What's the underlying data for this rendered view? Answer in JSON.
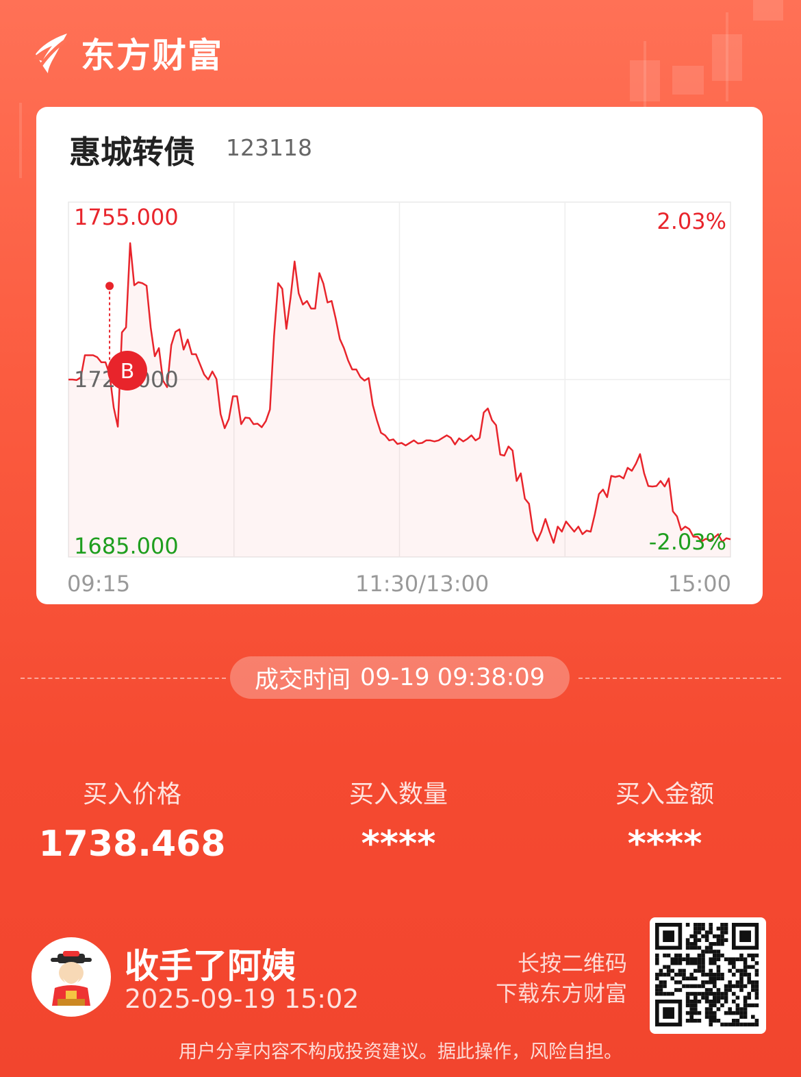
{
  "brand": {
    "name": "东方财富",
    "logo_icon": "eastmoney-logo-icon"
  },
  "stock": {
    "name": "惠城转债",
    "code": "123118"
  },
  "chart_data": {
    "type": "line",
    "title": "",
    "y_max_label": "1755.000",
    "y_mid_label": "1720.000",
    "y_min_label": "1685.000",
    "pct_max_label": "2.03%",
    "pct_min_label": "-2.03%",
    "ylim": [
      1685,
      1755
    ],
    "x_ticks": [
      "09:15",
      "11:30/13:00",
      "15:00"
    ],
    "grid": true,
    "line_color": "#e8242b",
    "up_color": "#e8242b",
    "down_color": "#1e9e1e",
    "buy_marker": {
      "label": "B",
      "time_index": 10,
      "price": 1738.468
    },
    "series": [
      {
        "values": [
          1720.0,
          1720.0,
          1719.9,
          1720.4,
          1724.8,
          1724.8,
          1724.8,
          1724.4,
          1723.4,
          1723.4,
          1721.0,
          1714.5,
          1710.7,
          1729.3,
          1730.3,
          1746.9,
          1738.6,
          1739.2,
          1739.0,
          1738.5,
          1730.3,
          1724.6,
          1726.2,
          1719.8,
          1718.5,
          1726.8,
          1729.4,
          1729.9,
          1725.9,
          1727.9,
          1725.0,
          1725.0,
          1723.0,
          1721.0,
          1720.0,
          1721.6,
          1720.1,
          1713.2,
          1710.4,
          1712.2,
          1716.7,
          1716.7,
          1711.2,
          1712.5,
          1712.4,
          1711.2,
          1711.3,
          1710.6,
          1711.8,
          1714.1,
          1728.6,
          1739.0,
          1737.9,
          1730.0,
          1736.0,
          1743.3,
          1737.0,
          1734.8,
          1735.5,
          1734.0,
          1734.0,
          1741.0,
          1738.9,
          1735.2,
          1735.5,
          1732.0,
          1728.0,
          1726.2,
          1723.8,
          1722.0,
          1722.0,
          1720.5,
          1719.8,
          1720.3,
          1715.0,
          1712.0,
          1709.5,
          1709.0,
          1708.0,
          1708.2,
          1707.3,
          1707.5,
          1707.0,
          1707.5,
          1708.0,
          1707.4,
          1707.5,
          1708.0,
          1708.0,
          1707.8,
          1708.0,
          1708.5,
          1709.0,
          1708.5,
          1707.2,
          1708.4,
          1707.8,
          1708.3,
          1709.0,
          1708.0,
          1708.5,
          1713.5,
          1714.3,
          1712.0,
          1711.0,
          1705.2,
          1705.0,
          1706.8,
          1706.0,
          1700.0,
          1701.5,
          1696.5,
          1695.5,
          1690.0,
          1688.2,
          1690.0,
          1692.5,
          1690.0,
          1687.8,
          1691.0,
          1690.0,
          1692.0,
          1691.0,
          1690.0,
          1691.0,
          1689.5,
          1690.2,
          1690.0,
          1693.4,
          1697.4,
          1698.3,
          1696.8,
          1701.0,
          1700.8,
          1701.0,
          1700.5,
          1702.6,
          1702.0,
          1703.4,
          1705.3,
          1701.5,
          1699.0,
          1698.9,
          1699.0,
          1700.0,
          1698.9,
          1700.5,
          1694.0,
          1693.0,
          1690.3,
          1691.0,
          1690.5,
          1689.0,
          1689.0,
          1688.1,
          1688.6,
          1688.3,
          1688.8,
          1689.5,
          1688.0,
          1688.7,
          1688.5
        ]
      }
    ]
  },
  "deal": {
    "label": "成交时间",
    "value": "09-19 09:38:09"
  },
  "stats": [
    {
      "label": "买入价格",
      "value": "1738.468"
    },
    {
      "label": "买入数量",
      "value": "****"
    },
    {
      "label": "买入金额",
      "value": "****"
    }
  ],
  "user": {
    "name": "收手了阿姨",
    "time": "2025-09-19 15:02",
    "avatar_icon": "god-of-wealth-avatar-icon"
  },
  "qr": {
    "hint_line1": "长按二维码",
    "hint_line2": "下载东方财富",
    "icon": "qr-code-icon"
  },
  "disclaimer": "用户分享内容不构成投资建议。据此操作，风险自担。"
}
